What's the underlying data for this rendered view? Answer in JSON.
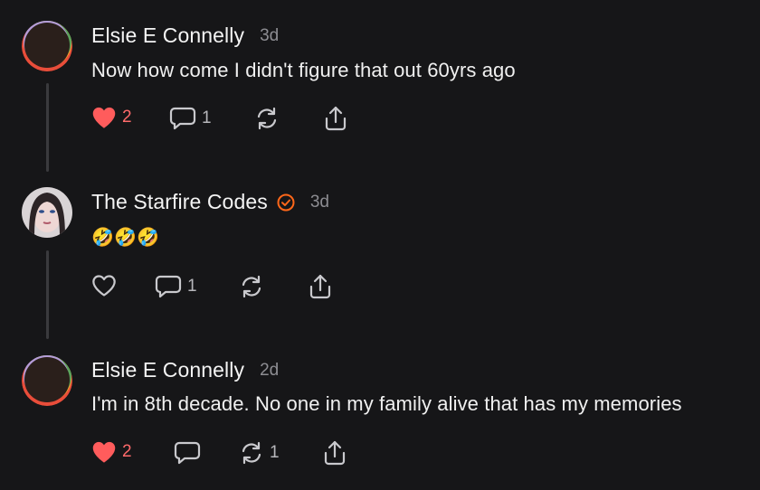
{
  "comments": [
    {
      "author": "Elsie E Connelly",
      "time": "3d",
      "text": "Now how come I didn't figure that out 60yrs ago",
      "likes": "2",
      "liked": true,
      "replies": "1",
      "restacks": ""
    },
    {
      "author": "The Starfire Codes",
      "verified": true,
      "time": "3d",
      "text": "🤣🤣🤣",
      "likes": "",
      "liked": false,
      "replies": "1",
      "restacks": ""
    },
    {
      "author": "Elsie E Connelly",
      "time": "2d",
      "text": "I'm in 8th decade. No one in my family alive that has my memories",
      "likes": "2",
      "liked": true,
      "replies": "",
      "restacks": "1"
    }
  ],
  "icons": {
    "like": "heart-icon",
    "reply": "comment-bubble-icon",
    "restack": "restack-icon",
    "share": "share-icon",
    "verified": "verified-check-icon"
  },
  "colors": {
    "background": "#161618",
    "liked": "#ff5c5c",
    "verified": "#ff6719",
    "muted": "#8d8d92"
  }
}
